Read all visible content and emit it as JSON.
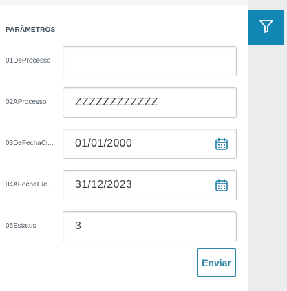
{
  "section_title": "PARÂMETROS",
  "fields": [
    {
      "label": "01DeProcesso",
      "value": "",
      "type": "text"
    },
    {
      "label": "02AProcesso",
      "value": "ZZZZZZZZZZZZ",
      "type": "text"
    },
    {
      "label": "03DeFechaCi...",
      "value": "01/01/2000",
      "type": "date"
    },
    {
      "label": "04AFechaCie...",
      "value": "31/12/2023",
      "type": "date"
    },
    {
      "label": "05Estatus",
      "value": "3",
      "type": "text"
    }
  ],
  "submit_label": "Enviar",
  "sidebar": {
    "filter_icon": "filter-icon"
  },
  "colors": {
    "accent": "#1387b4",
    "button_text": "#2c85a8",
    "rail": "#ececec"
  }
}
